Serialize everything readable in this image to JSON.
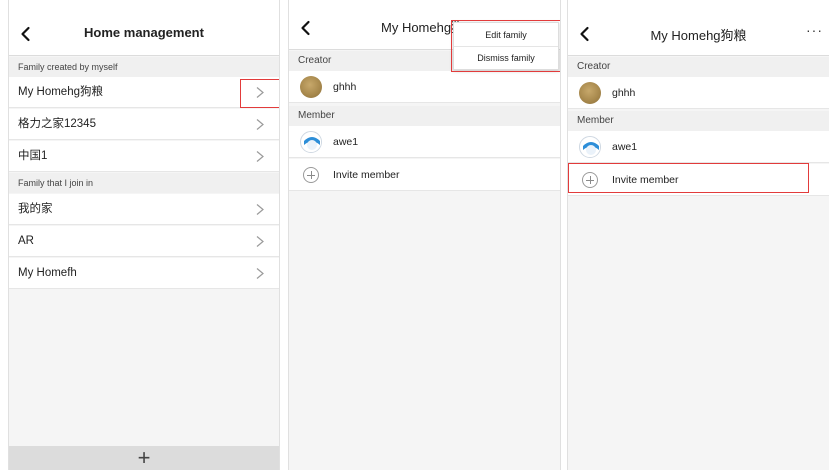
{
  "colors": {
    "highlight": "#e23b3b",
    "bottom_bar": "#dcdcdc",
    "section_bg": "#f0f0f0"
  },
  "panel1": {
    "title": "Home management",
    "section_created": "Family created by myself",
    "created_families": [
      {
        "name": "My Homehg狗粮"
      },
      {
        "name": "格力之家12345"
      },
      {
        "name": "中国1"
      }
    ],
    "section_joined": "Family that I join in",
    "joined_families": [
      {
        "name": "我的家"
      },
      {
        "name": "AR"
      },
      {
        "name": "My Homefh"
      }
    ],
    "add_label": "+"
  },
  "panel2": {
    "title": "My Homehg狗",
    "creator_header": "Creator",
    "creator_name": "ghhh",
    "member_header": "Member",
    "member_name": "awe1",
    "invite_label": "Invite member",
    "menu": {
      "edit": "Edit family",
      "dismiss": "Dismiss family"
    }
  },
  "panel3": {
    "title": "My Homehg狗粮",
    "more_label": "···",
    "creator_header": "Creator",
    "creator_name": "ghhh",
    "member_header": "Member",
    "member_name": "awe1",
    "invite_label": "Invite member"
  }
}
